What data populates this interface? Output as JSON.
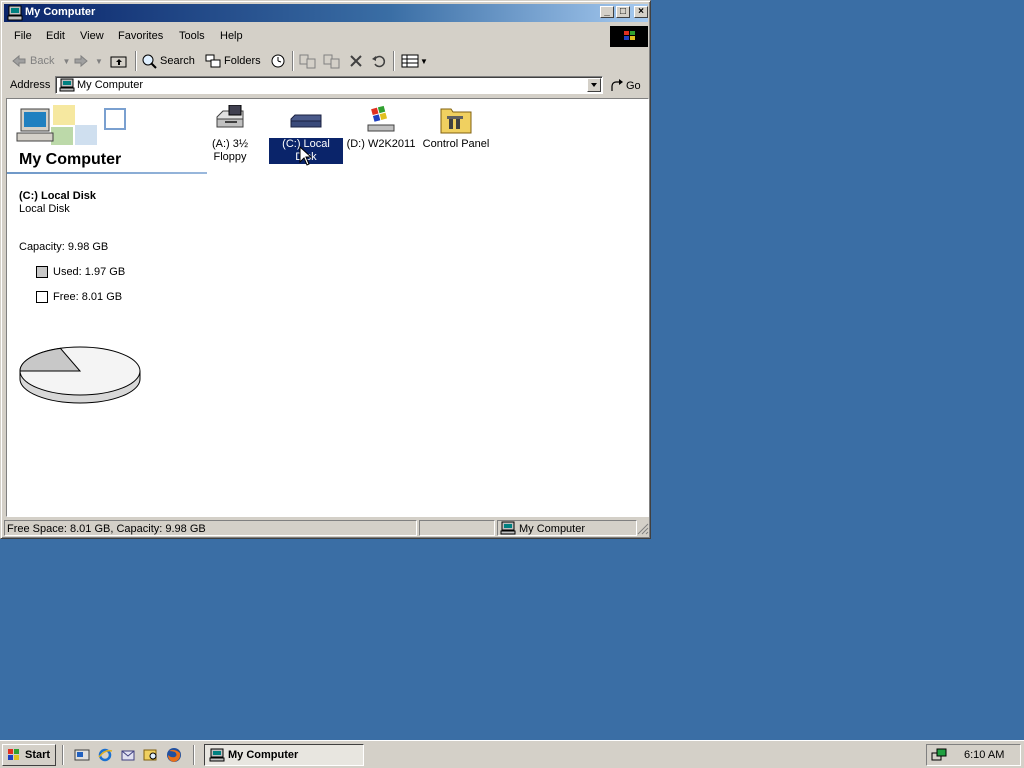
{
  "window": {
    "title": "My Computer",
    "menu": [
      "File",
      "Edit",
      "View",
      "Favorites",
      "Tools",
      "Help"
    ],
    "toolbar": {
      "back_label": "Back",
      "search_label": "Search",
      "folders_label": "Folders"
    },
    "address": {
      "label": "Address",
      "value": "My Computer",
      "go_label": "Go"
    },
    "left_panel": {
      "title": "My Computer",
      "selected_name": "(C:) Local Disk",
      "selected_type": "Local Disk",
      "capacity": "Capacity: 9.98 GB",
      "used": "Used: 1.97 GB",
      "free": "Free: 8.01 GB",
      "used_fraction": 0.197
    },
    "icons": [
      {
        "line1": "(A:) 3½",
        "line2": "Floppy",
        "icon": "floppy-drive-icon"
      },
      {
        "line1": "(C:) Local Disk",
        "icon": "hard-disk-icon",
        "selected": true
      },
      {
        "line1": "(D:) W2K2011",
        "icon": "cd-drive-icon"
      },
      {
        "line1": "Control Panel",
        "icon": "control-panel-folder-icon"
      }
    ],
    "status": {
      "left": "Free Space: 8.01 GB, Capacity: 9.98 GB",
      "right": "My Computer"
    }
  },
  "taskbar": {
    "start_label": "Start",
    "task_label": "My Computer",
    "clock": "6:10 AM"
  },
  "colors": {
    "desktop": "#3a6ea5",
    "titlebar": "#0a246a",
    "selection": "#0a246a",
    "face": "#d4d0c8"
  }
}
